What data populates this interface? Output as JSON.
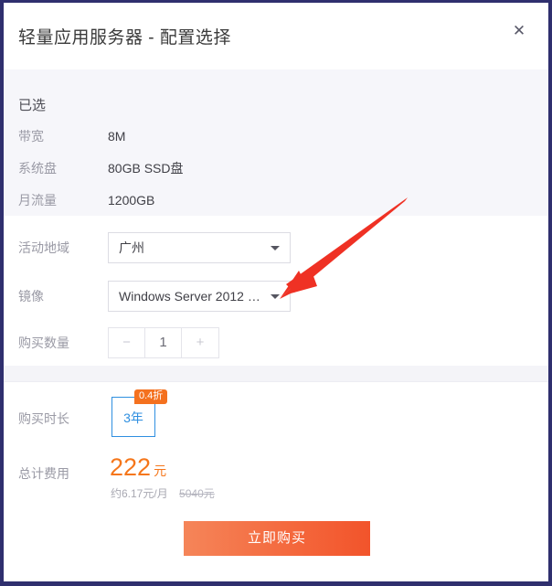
{
  "dialog": {
    "title": "轻量应用服务器 - 配置选择",
    "close_icon": "close-icon",
    "close_glyph": "✕"
  },
  "selected": {
    "heading": "已选",
    "rows": [
      {
        "label": "带宽",
        "value": "8M"
      },
      {
        "label": "系统盘",
        "value": "80GB SSD盘"
      },
      {
        "label": "月流量",
        "value": "1200GB"
      }
    ]
  },
  "form": {
    "region": {
      "label": "活动地域",
      "value": "广州",
      "caret_icon": "chevron-down-icon"
    },
    "image": {
      "label": "镜像",
      "value": "Windows Server 2012 …",
      "caret_icon": "chevron-down-icon"
    },
    "quantity": {
      "label": "购买数量",
      "value": "1",
      "decrement_label": "−",
      "increment_label": "+"
    }
  },
  "pricing": {
    "duration": {
      "label": "购买时长",
      "value": "3年",
      "discount_badge": "0.4折"
    },
    "total": {
      "label": "总计费用",
      "amount": "222",
      "currency": "元",
      "monthly": "约6.17元/月",
      "original": "5040元"
    },
    "buy_button": "立即购买"
  },
  "colors": {
    "accent_orange": "#f5761a",
    "badge_orange": "#f4711f",
    "link_blue": "#2f8fe0",
    "annotation_red": "#ef3124",
    "panel_grey": "#f6f6fa",
    "window_border_navy": "#2f2f6e"
  },
  "annotation": {
    "arrow_icon": "arrow-pointer-icon",
    "points_to": "镜像"
  }
}
